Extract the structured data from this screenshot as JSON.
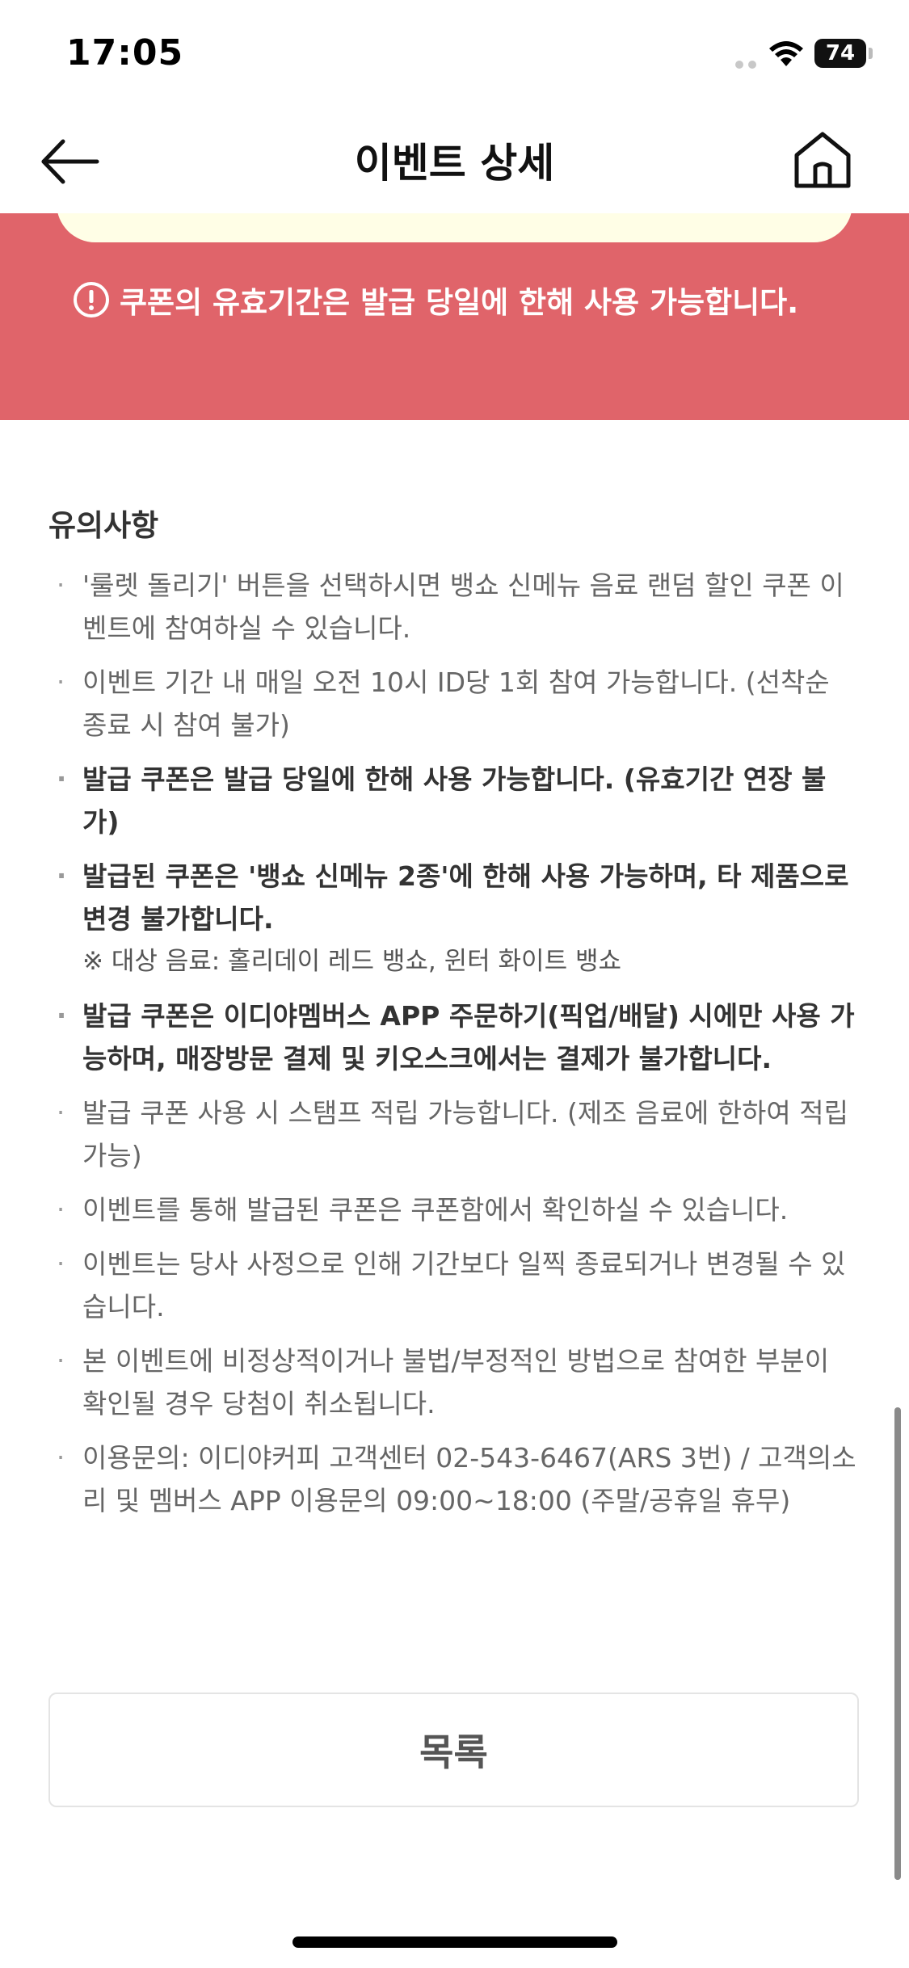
{
  "status_bar": {
    "time": "17:05",
    "battery": "74"
  },
  "header": {
    "title": "이벤트 상세",
    "back_icon": "arrow-left-icon",
    "home_icon": "home-icon"
  },
  "banner": {
    "notice": "쿠폰의 유효기간은 발급 당일에 한해 사용 가능합니다.",
    "background_color": "#e0646a",
    "pill_color": "#fffee6"
  },
  "notes": {
    "title": "유의사항",
    "items": [
      {
        "text": "'룰렛 돌리기' 버튼을 선택하시면 뱅쇼 신메뉴 음료 랜덤 할인 쿠폰 이벤트에 참여하실 수 있습니다.",
        "bold": false
      },
      {
        "text": "이벤트 기간 내 매일 오전 10시 ID당 1회 참여 가능합니다. (선착순 종료 시 참여 불가)",
        "bold": false
      },
      {
        "text": "발급 쿠폰은 발급 당일에 한해 사용 가능합니다. (유효기간 연장 불가)",
        "bold": true
      },
      {
        "text": "발급된 쿠폰은 '뱅쇼 신메뉴 2종'에 한해 사용 가능하며, 타 제품으로 변경 불가합니다.",
        "bold": true,
        "sub": "※ 대상 음료: 홀리데이 레드 뱅쇼, 윈터 화이트 뱅쇼"
      },
      {
        "text": "발급 쿠폰은 이디야멤버스 APP 주문하기(픽업/배달) 시에만 사용 가능하며, 매장방문 결제 및 키오스크에서는 결제가 불가합니다.",
        "bold": true
      },
      {
        "text": "발급 쿠폰 사용 시 스탬프 적립 가능합니다. (제조 음료에 한하여 적립 가능)",
        "bold": false
      },
      {
        "text": "이벤트를 통해 발급된 쿠폰은 쿠폰함에서 확인하실 수 있습니다.",
        "bold": false
      },
      {
        "text": "이벤트는 당사 사정으로 인해 기간보다 일찍 종료되거나 변경될 수 있습니다.",
        "bold": false
      },
      {
        "text": "본 이벤트에 비정상적이거나 불법/부정적인 방법으로 참여한 부분이 확인될 경우 당첨이 취소됩니다.",
        "bold": false
      },
      {
        "text": "이용문의: 이디야커피 고객센터 02-543-6467(ARS 3번) / 고객의소리 및 멤버스 APP 이용문의 09:00~18:00 (주말/공휴일 휴무)",
        "bold": false
      }
    ]
  },
  "footer": {
    "list_button": "목록"
  }
}
